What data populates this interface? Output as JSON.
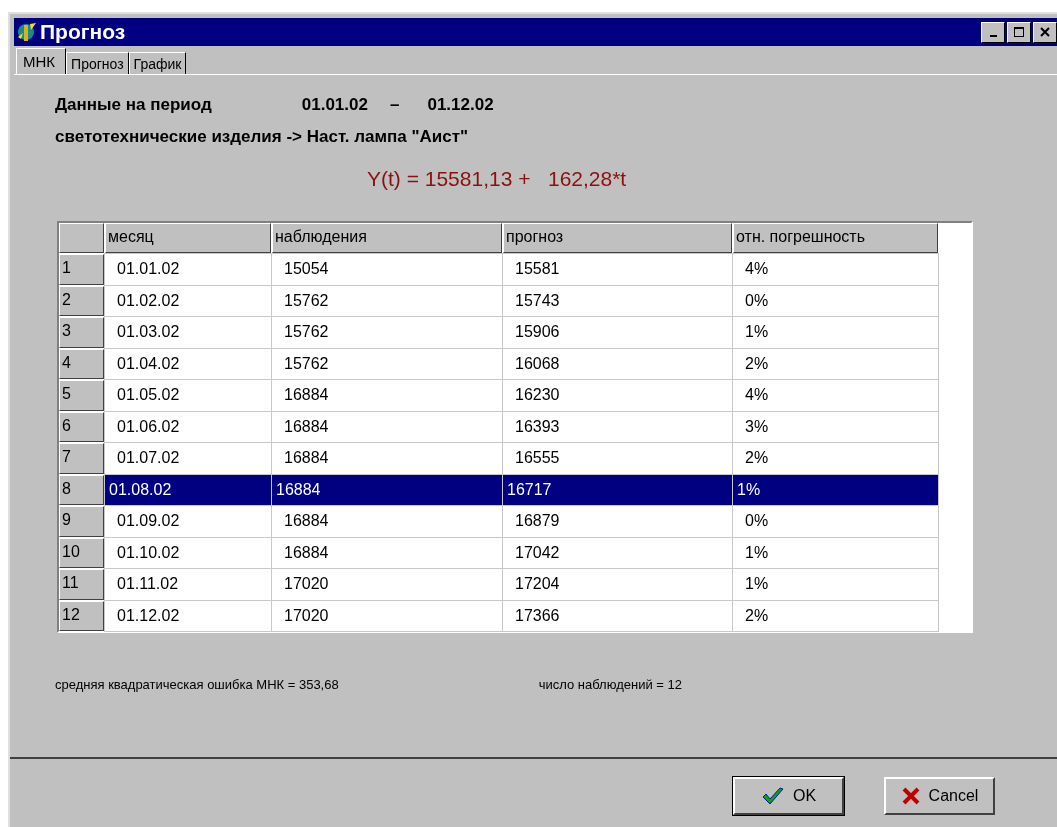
{
  "window": {
    "title": "Прогноз"
  },
  "tabs": [
    {
      "label": "МНК",
      "selected": true
    },
    {
      "label": "Прогноз",
      "selected": false
    },
    {
      "label": "График",
      "selected": false
    }
  ],
  "period": {
    "label": "Данные на период",
    "from": "01.01.02",
    "dash": "–",
    "to": "01.12.02"
  },
  "category": "светотехнические изделия -> Наст. лампа \"Аист\"",
  "formula": "Y(t) = 15581,13 +   162,28*t",
  "table": {
    "columns": [
      "месяц",
      "наблюдения",
      "прогноз",
      "отн. погрешность"
    ],
    "rows": [
      {
        "num": "1",
        "cells": [
          "01.01.02",
          "15054",
          "15581",
          "4%"
        ],
        "selected": false
      },
      {
        "num": "2",
        "cells": [
          "01.02.02",
          "15762",
          "15743",
          "0%"
        ],
        "selected": false
      },
      {
        "num": "3",
        "cells": [
          "01.03.02",
          "15762",
          "15906",
          "1%"
        ],
        "selected": false
      },
      {
        "num": "4",
        "cells": [
          "01.04.02",
          "15762",
          "16068",
          "2%"
        ],
        "selected": false
      },
      {
        "num": "5",
        "cells": [
          "01.05.02",
          "16884",
          "16230",
          "4%"
        ],
        "selected": false
      },
      {
        "num": "6",
        "cells": [
          "01.06.02",
          "16884",
          "16393",
          "3%"
        ],
        "selected": false
      },
      {
        "num": "7",
        "cells": [
          "01.07.02",
          "16884",
          "16555",
          "2%"
        ],
        "selected": false
      },
      {
        "num": "8",
        "cells": [
          "01.08.02",
          "16884",
          "16717",
          "1%"
        ],
        "selected": true
      },
      {
        "num": "9",
        "cells": [
          "01.09.02",
          "16884",
          "16879",
          "0%"
        ],
        "selected": false
      },
      {
        "num": "10",
        "cells": [
          "01.10.02",
          "16884",
          "17042",
          "1%"
        ],
        "selected": false
      },
      {
        "num": "11",
        "cells": [
          "01.11.02",
          "17020",
          "17204",
          "1%"
        ],
        "selected": false
      },
      {
        "num": "12",
        "cells": [
          "01.12.02",
          "17020",
          "17366",
          "2%"
        ],
        "selected": false
      }
    ]
  },
  "stats": {
    "error": "средняя квадратическая ошибка МНК =   353,68",
    "count": "число наблюдений = 12"
  },
  "buttons": [
    {
      "kind": "ok",
      "label": "OK"
    },
    {
      "kind": "cancel",
      "label": "Cancel"
    }
  ]
}
